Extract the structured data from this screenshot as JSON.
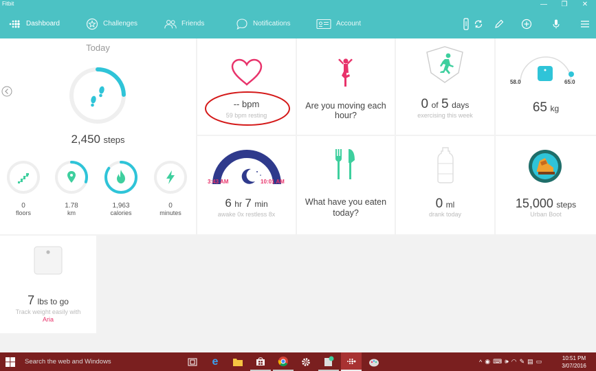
{
  "window": {
    "title": "Fitbit",
    "minimize": "—",
    "restore": "❐",
    "close": "✕"
  },
  "nav": {
    "dashboard": "Dashboard",
    "challenges": "Challenges",
    "friends": "Friends",
    "notifications": "Notifications",
    "account": "Account"
  },
  "steps": {
    "heading": "Today",
    "value": "2,450",
    "unit": "steps",
    "progress": 0.245
  },
  "stats": [
    {
      "value": "0",
      "label": "floors",
      "progress": 0.0
    },
    {
      "value": "1.78",
      "label": "km",
      "progress": 0.3
    },
    {
      "value": "1,963",
      "label": "calories",
      "progress": 0.85
    },
    {
      "value": "0",
      "label": "minutes",
      "progress": 0.0
    }
  ],
  "heart": {
    "value": "-- bpm",
    "sub": "59 bpm resting"
  },
  "hourly": {
    "text1": "Are you moving each",
    "text2": "hour?"
  },
  "exercise": {
    "v1": "0",
    "of": "of",
    "v2": "5",
    "unit": "days",
    "sub": "exercising this week"
  },
  "weight": {
    "min": "58.0",
    "max": "65.0",
    "value": "65",
    "unit": "kg"
  },
  "sleep": {
    "start": "3:43 AM",
    "end": "10:01 AM",
    "hr": "6",
    "hr_unit": "hr",
    "min": "7",
    "min_unit": "min",
    "sub": "awake 0x restless 8x"
  },
  "food": {
    "text1": "What have you eaten",
    "text2": "today?"
  },
  "water": {
    "value": "0",
    "unit": "ml",
    "sub": "drank today"
  },
  "badge": {
    "value": "15,000",
    "unit": "steps",
    "sub": "Urban Boot"
  },
  "aria": {
    "value": "7",
    "unit": "lbs to go",
    "sub": "Track weight easily with",
    "link": "Aria"
  },
  "taskbar": {
    "search": "Search the web and Windows",
    "time": "10:51 PM",
    "date": "3/07/2016"
  },
  "colors": {
    "teal": "#4cc2c4",
    "cyan": "#2fc4d8",
    "pink": "#e8336b",
    "green": "#3ecf9e",
    "navy": "#2f3a8c",
    "taskbar": "#7a1f1f"
  }
}
